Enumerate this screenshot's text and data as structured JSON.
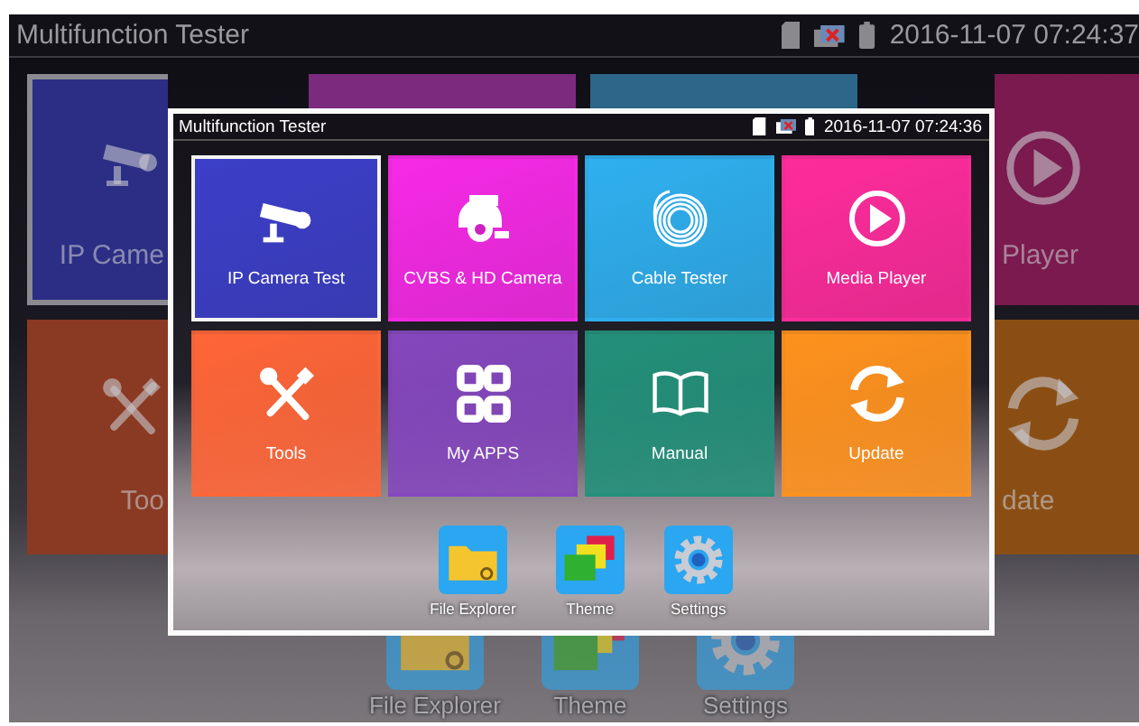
{
  "background_screen": {
    "title": "Multifunction Tester",
    "datetime": "2016-11-07 07:24:37",
    "tile_rows": [
      [
        {
          "kind": "camera",
          "label": "IP Came",
          "color": "#2b2e84",
          "selected": true
        },
        {
          "kind": "none",
          "color": "#7c2a7e",
          "selected": false
        },
        {
          "kind": "none",
          "color": "#2c6688",
          "selected": false
        },
        {
          "kind": "play",
          "label": "Player",
          "color": "#7a1a4e",
          "selected": false
        }
      ],
      [
        {
          "kind": "tools",
          "label": "Too",
          "color": "#8a3a22",
          "selected": false
        },
        {
          "kind": "update",
          "label": "date",
          "color": "#8a4e14",
          "selected": false
        }
      ]
    ],
    "dock": [
      {
        "kind": "folder",
        "label": "File Explorer"
      },
      {
        "kind": "theme",
        "label": "Theme"
      },
      {
        "kind": "gear",
        "label": "Settings"
      }
    ]
  },
  "dialog": {
    "title": "Multifunction Tester",
    "datetime": "2016-11-07 07:24:36",
    "tiles": [
      {
        "kind": "camera",
        "label": "IP Camera Test",
        "color": "#3c3fc8",
        "selected": true
      },
      {
        "kind": "ptz",
        "label": "CVBS & HD Camera",
        "color": "#f62ae6",
        "selected": false
      },
      {
        "kind": "cable",
        "label": "Cable Tester",
        "color": "#2fb0ef",
        "selected": false
      },
      {
        "kind": "play",
        "label": "Media Player",
        "color": "#ff2c9c",
        "selected": false
      },
      {
        "kind": "tools",
        "label": "Tools",
        "color": "#ff6638",
        "selected": false
      },
      {
        "kind": "apps",
        "label": "My APPS",
        "color": "#8547bd",
        "selected": false
      },
      {
        "kind": "book",
        "label": "Manual",
        "color": "#23907a",
        "selected": false
      },
      {
        "kind": "update",
        "label": "Update",
        "color": "#ff921e",
        "selected": false
      }
    ],
    "dock": [
      {
        "kind": "folder",
        "label": "File Explorer"
      },
      {
        "kind": "theme",
        "label": "Theme"
      },
      {
        "kind": "gear",
        "label": "Settings"
      }
    ]
  }
}
